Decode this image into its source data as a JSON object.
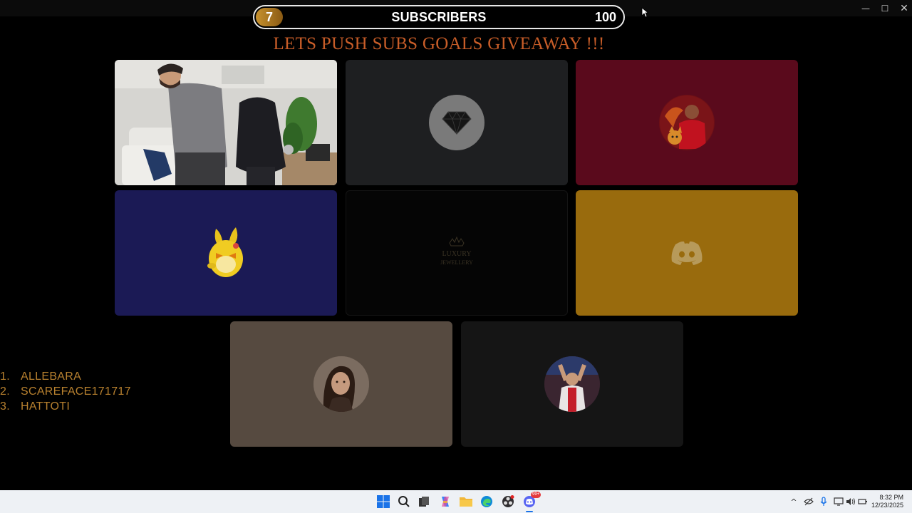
{
  "window": {
    "controls": {
      "minimize": "—",
      "maximize": "☐",
      "close": "✕"
    }
  },
  "subscriber_bar": {
    "current": "7",
    "label": "SUBSCRIBERS",
    "goal": "100",
    "progress_fraction": 0.07
  },
  "headline": "LETS PUSH SUBS GOALS GIVEAWAY !!!",
  "tiles": [
    {
      "kind": "camera",
      "background": "#c9c9c7"
    },
    {
      "kind": "avatar",
      "icon": "diamond-icon",
      "background": "#1e1f21"
    },
    {
      "kind": "avatar",
      "icon": "football-player-avatar",
      "background": "#5a0a1c"
    },
    {
      "kind": "avatar",
      "icon": "yellow-rabbit-avatar",
      "background": "#1b1a55"
    },
    {
      "kind": "logo",
      "icon": "crown-icon",
      "background": "#050505"
    },
    {
      "kind": "avatar",
      "icon": "discord-icon",
      "background": "#996b0d"
    },
    {
      "kind": "avatar",
      "icon": "woman-avatar",
      "background": "#564a40"
    },
    {
      "kind": "avatar",
      "icon": "player-celebrating-avatar",
      "background": "#151515"
    }
  ],
  "winners": [
    {
      "num": "1.",
      "name": "ALLEBARA"
    },
    {
      "num": "2.",
      "name": "SCAREFACE171717"
    },
    {
      "num": "3.",
      "name": "HATTOTI"
    }
  ],
  "taskbar": {
    "apps": [
      "start-icon",
      "search-icon",
      "task-view-icon",
      "copilot-icon",
      "file-explorer-icon",
      "edge-icon",
      "obs-icon",
      "discord-icon"
    ],
    "discord_badge": "99+",
    "tray": {
      "chevron": "^"
    },
    "time": "8:32 PM",
    "date": "12/23/2025"
  },
  "colors": {
    "headline": "#c85d28",
    "winners": "#b8812f",
    "count_badge": "#b07b22"
  }
}
